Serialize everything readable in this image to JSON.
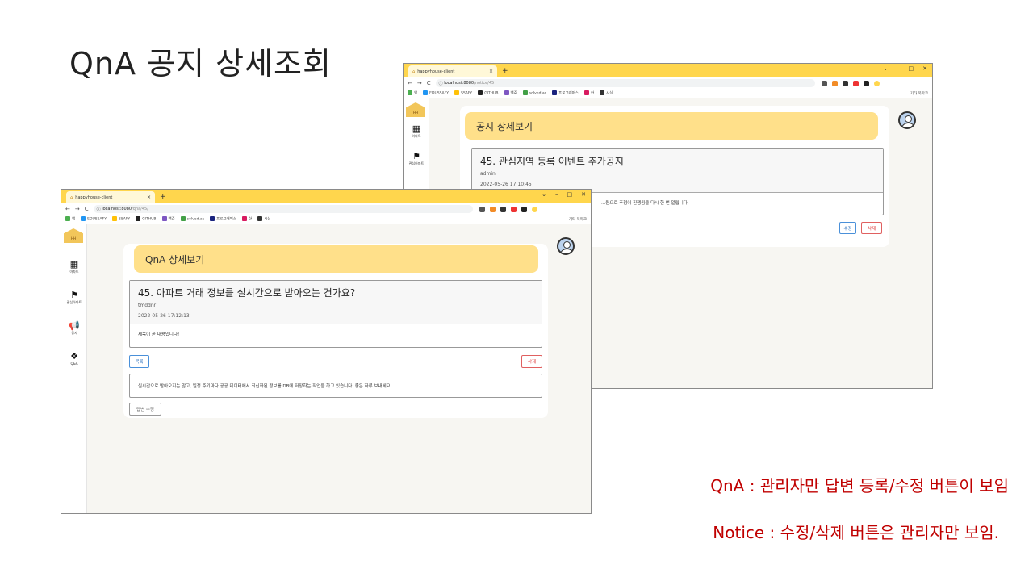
{
  "slide": {
    "title": "QnA 공지 상세조회",
    "note_qna": "QnA : 관리자만 답변 등록/수정 버튼이 보임",
    "note_notice": "Notice : 수정/삭제 버튼은 관리자만 보임."
  },
  "notice_window": {
    "tab_title": "happyhouse-client",
    "url_host": "localhost:8080",
    "url_path": "/notice/45",
    "bookmarks": [
      "앱",
      "EDUSSAFY",
      "SSAFY",
      "GITHUB",
      "백준",
      "solved.ac",
      "프로그래머스",
      "한",
      "시심"
    ],
    "bookmarks_right": "기타 북마크",
    "sidebar": [
      "아파트",
      "관심아파트"
    ],
    "header": "공지 상세보기",
    "post_title": "45. 관심지역 등록 이벤트 추가공지",
    "post_author": "admin",
    "post_date": "2022-05-26 17:10:45",
    "post_body": "...원으로 추첨이 진행됨을 다시 한 번 알립니다.",
    "edit_button": "수정",
    "delete_button": "삭제"
  },
  "qna_window": {
    "tab_title": "happyhouse-client",
    "url_host": "localhost:8080",
    "url_path": "/qna/45/",
    "bookmarks": [
      "앱",
      "EDUSSAFY",
      "SSAFY",
      "GITHUB",
      "백준",
      "solved.ac",
      "프로그래머스",
      "한",
      "시심"
    ],
    "bookmarks_right": "기타 북마크",
    "sidebar": [
      "아파트",
      "관심아파트",
      "공지",
      "Q&A"
    ],
    "header": "QnA 상세보기",
    "post_title": "45. 아파트 거래 정보를 실시간으로 받아오는 건가요?",
    "post_author": "tmddnr",
    "post_date": "2022-05-26 17:12:13",
    "post_body": "제목이 곧 내용입니다!",
    "list_button": "목록",
    "delete_button": "삭제",
    "answer_text": "실시간으로 받아오지는 않고, 일정 주기마다 공공 데이터에서 최신화된 정보를 DB에 저장하는 작업을 하고 있습니다. 좋은 하루 보내세요.",
    "answer_edit_button": "답변 수정"
  },
  "colors": {
    "tab_bar": "#ffd64d",
    "header_box": "#ffe08a",
    "note_text": "#c00000"
  }
}
